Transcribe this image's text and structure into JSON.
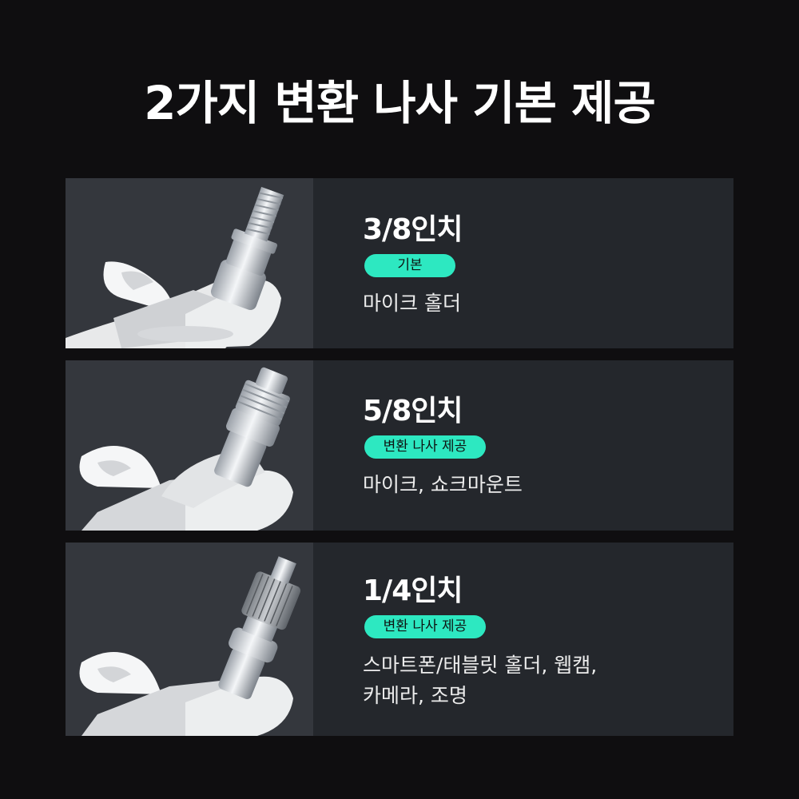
{
  "title": "2가지 변환 나사 기본 제공",
  "items": [
    {
      "size": "3/8인치",
      "badge": "기본",
      "use_lines": [
        "마이크 홀더"
      ],
      "photo_icon": "screw-adapter-3-8-photo"
    },
    {
      "size": "5/8인치",
      "badge": "변환 나사 제공",
      "use_lines": [
        "마이크, 쇼크마운트"
      ],
      "photo_icon": "screw-adapter-5-8-photo"
    },
    {
      "size": "1/4인치",
      "badge": "변환 나사 제공",
      "use_lines": [
        "스마트폰/태블릿 홀더, 웹캠,",
        "카메라, 조명"
      ],
      "photo_icon": "screw-adapter-1-4-photo"
    }
  ],
  "colors": {
    "background": "#0f0e10",
    "card": "#24272c",
    "photo_bg": "#34373d",
    "badge": "#2de8c1"
  }
}
